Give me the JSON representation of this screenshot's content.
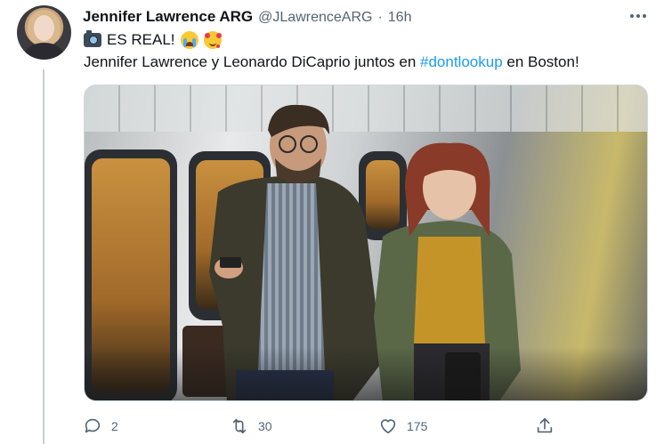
{
  "tweet": {
    "display_name": "Jennifer Lawrence ARG",
    "handle": "@JLawrenceARG",
    "separator": "·",
    "time": "16h",
    "text_line1": "ES REAL!",
    "text_line2_prefix": "Jennifer Lawrence y Leonardo DiCaprio juntos en ",
    "hashtag": "#dontlookup",
    "text_line2_suffix": " en Boston!",
    "icons": {
      "emoji1": "camera-with-flash-emoji",
      "emoji2": "loudly-crying-face-emoji",
      "emoji3": "smiling-face-with-hearts-emoji"
    }
  },
  "actions": {
    "reply_count": "2",
    "retweet_count": "30",
    "like_count": "175"
  },
  "colors": {
    "accent": "#1d9bf0",
    "secondary_text": "#536471",
    "primary_text": "#0f1419"
  }
}
